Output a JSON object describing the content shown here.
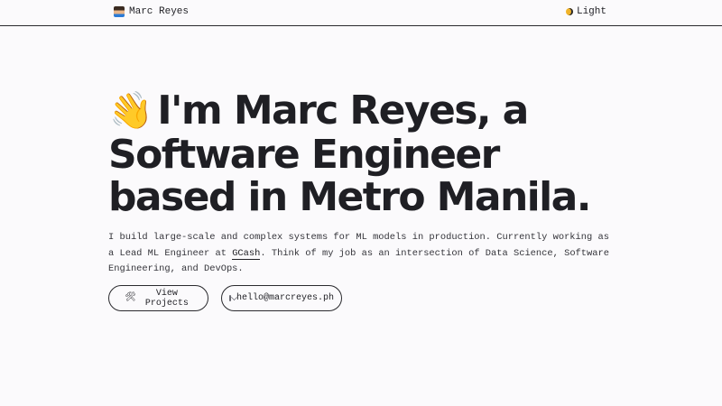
{
  "nav": {
    "brand_name": "Marc Reyes",
    "brand_icon": "technologist-avatar-icon",
    "theme_label": "Light",
    "theme_icon": "moon-icon"
  },
  "hero": {
    "wave_emoji": "👋",
    "headline": "I'm Marc Reyes, a Software Engineer based in Metro Manila.",
    "bio_part1": "I build large-scale and complex systems for ML models in production. Currently working as a Lead ML Engineer at ",
    "bio_link": "GCash",
    "bio_part2": ". Think of my job as an intersection of Data Science, Software Engineering, and DevOps."
  },
  "buttons": {
    "projects_icon": "🛠",
    "projects_label": "View Projects",
    "email_label": "hello@marcreyes.ph"
  }
}
